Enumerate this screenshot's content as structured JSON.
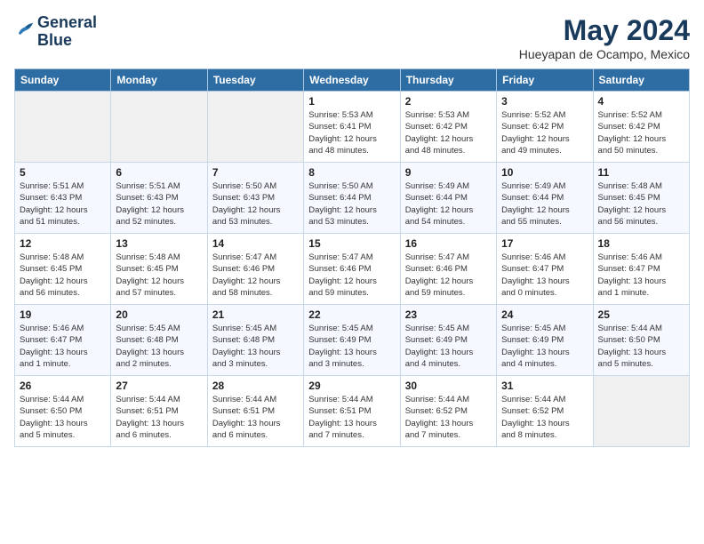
{
  "header": {
    "logo_line1": "General",
    "logo_line2": "Blue",
    "month": "May 2024",
    "location": "Hueyapan de Ocampo, Mexico"
  },
  "weekdays": [
    "Sunday",
    "Monday",
    "Tuesday",
    "Wednesday",
    "Thursday",
    "Friday",
    "Saturday"
  ],
  "weeks": [
    [
      {
        "day": "",
        "info": ""
      },
      {
        "day": "",
        "info": ""
      },
      {
        "day": "",
        "info": ""
      },
      {
        "day": "1",
        "info": "Sunrise: 5:53 AM\nSunset: 6:41 PM\nDaylight: 12 hours\nand 48 minutes."
      },
      {
        "day": "2",
        "info": "Sunrise: 5:53 AM\nSunset: 6:42 PM\nDaylight: 12 hours\nand 48 minutes."
      },
      {
        "day": "3",
        "info": "Sunrise: 5:52 AM\nSunset: 6:42 PM\nDaylight: 12 hours\nand 49 minutes."
      },
      {
        "day": "4",
        "info": "Sunrise: 5:52 AM\nSunset: 6:42 PM\nDaylight: 12 hours\nand 50 minutes."
      }
    ],
    [
      {
        "day": "5",
        "info": "Sunrise: 5:51 AM\nSunset: 6:43 PM\nDaylight: 12 hours\nand 51 minutes."
      },
      {
        "day": "6",
        "info": "Sunrise: 5:51 AM\nSunset: 6:43 PM\nDaylight: 12 hours\nand 52 minutes."
      },
      {
        "day": "7",
        "info": "Sunrise: 5:50 AM\nSunset: 6:43 PM\nDaylight: 12 hours\nand 53 minutes."
      },
      {
        "day": "8",
        "info": "Sunrise: 5:50 AM\nSunset: 6:44 PM\nDaylight: 12 hours\nand 53 minutes."
      },
      {
        "day": "9",
        "info": "Sunrise: 5:49 AM\nSunset: 6:44 PM\nDaylight: 12 hours\nand 54 minutes."
      },
      {
        "day": "10",
        "info": "Sunrise: 5:49 AM\nSunset: 6:44 PM\nDaylight: 12 hours\nand 55 minutes."
      },
      {
        "day": "11",
        "info": "Sunrise: 5:48 AM\nSunset: 6:45 PM\nDaylight: 12 hours\nand 56 minutes."
      }
    ],
    [
      {
        "day": "12",
        "info": "Sunrise: 5:48 AM\nSunset: 6:45 PM\nDaylight: 12 hours\nand 56 minutes."
      },
      {
        "day": "13",
        "info": "Sunrise: 5:48 AM\nSunset: 6:45 PM\nDaylight: 12 hours\nand 57 minutes."
      },
      {
        "day": "14",
        "info": "Sunrise: 5:47 AM\nSunset: 6:46 PM\nDaylight: 12 hours\nand 58 minutes."
      },
      {
        "day": "15",
        "info": "Sunrise: 5:47 AM\nSunset: 6:46 PM\nDaylight: 12 hours\nand 59 minutes."
      },
      {
        "day": "16",
        "info": "Sunrise: 5:47 AM\nSunset: 6:46 PM\nDaylight: 12 hours\nand 59 minutes."
      },
      {
        "day": "17",
        "info": "Sunrise: 5:46 AM\nSunset: 6:47 PM\nDaylight: 13 hours\nand 0 minutes."
      },
      {
        "day": "18",
        "info": "Sunrise: 5:46 AM\nSunset: 6:47 PM\nDaylight: 13 hours\nand 1 minute."
      }
    ],
    [
      {
        "day": "19",
        "info": "Sunrise: 5:46 AM\nSunset: 6:47 PM\nDaylight: 13 hours\nand 1 minute."
      },
      {
        "day": "20",
        "info": "Sunrise: 5:45 AM\nSunset: 6:48 PM\nDaylight: 13 hours\nand 2 minutes."
      },
      {
        "day": "21",
        "info": "Sunrise: 5:45 AM\nSunset: 6:48 PM\nDaylight: 13 hours\nand 3 minutes."
      },
      {
        "day": "22",
        "info": "Sunrise: 5:45 AM\nSunset: 6:49 PM\nDaylight: 13 hours\nand 3 minutes."
      },
      {
        "day": "23",
        "info": "Sunrise: 5:45 AM\nSunset: 6:49 PM\nDaylight: 13 hours\nand 4 minutes."
      },
      {
        "day": "24",
        "info": "Sunrise: 5:45 AM\nSunset: 6:49 PM\nDaylight: 13 hours\nand 4 minutes."
      },
      {
        "day": "25",
        "info": "Sunrise: 5:44 AM\nSunset: 6:50 PM\nDaylight: 13 hours\nand 5 minutes."
      }
    ],
    [
      {
        "day": "26",
        "info": "Sunrise: 5:44 AM\nSunset: 6:50 PM\nDaylight: 13 hours\nand 5 minutes."
      },
      {
        "day": "27",
        "info": "Sunrise: 5:44 AM\nSunset: 6:51 PM\nDaylight: 13 hours\nand 6 minutes."
      },
      {
        "day": "28",
        "info": "Sunrise: 5:44 AM\nSunset: 6:51 PM\nDaylight: 13 hours\nand 6 minutes."
      },
      {
        "day": "29",
        "info": "Sunrise: 5:44 AM\nSunset: 6:51 PM\nDaylight: 13 hours\nand 7 minutes."
      },
      {
        "day": "30",
        "info": "Sunrise: 5:44 AM\nSunset: 6:52 PM\nDaylight: 13 hours\nand 7 minutes."
      },
      {
        "day": "31",
        "info": "Sunrise: 5:44 AM\nSunset: 6:52 PM\nDaylight: 13 hours\nand 8 minutes."
      },
      {
        "day": "",
        "info": ""
      }
    ]
  ]
}
